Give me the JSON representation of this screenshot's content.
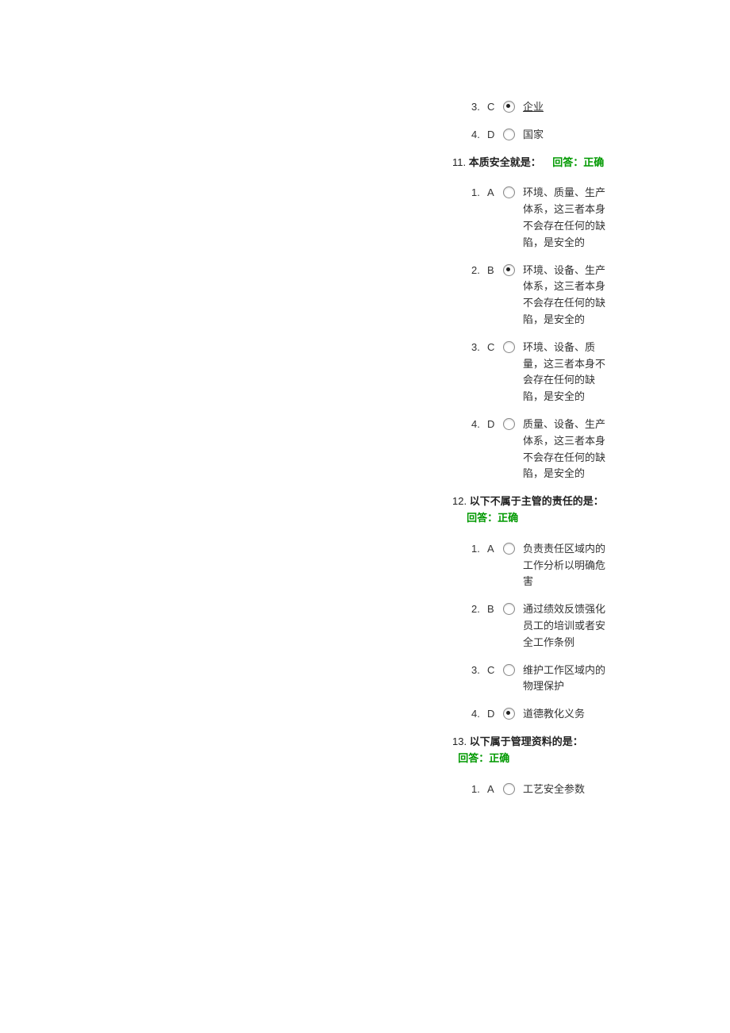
{
  "q_partial_top": {
    "options": [
      {
        "num": "3.",
        "letter": "C",
        "selected": true,
        "text": "企业",
        "underline": true
      },
      {
        "num": "4.",
        "letter": "D",
        "selected": false,
        "text": "国家"
      }
    ]
  },
  "q11": {
    "number": "11.",
    "title": "本质安全就是：",
    "answer_label": "回答：正确",
    "options": [
      {
        "num": "1.",
        "letter": "A",
        "selected": false,
        "text": "环境、质量、生产体系，这三者本身不会存在任何的缺陷，是安全的"
      },
      {
        "num": "2.",
        "letter": "B",
        "selected": true,
        "text": "环境、设备、生产体系，这三者本身不会存在任何的缺陷，是安全的"
      },
      {
        "num": "3.",
        "letter": "C",
        "selected": false,
        "text": "环境、设备、质量，这三者本身不会存在任何的缺陷，是安全的"
      },
      {
        "num": "4.",
        "letter": "D",
        "selected": false,
        "text": "质量、设备、生产体系，这三者本身不会存在任何的缺陷，是安全的"
      }
    ]
  },
  "q12": {
    "number": "12.",
    "title": "以下不属于主管的责任的是：",
    "answer_label": "回答：正确",
    "options": [
      {
        "num": "1.",
        "letter": "A",
        "selected": false,
        "text": "负责责任区域内的工作分析以明确危害"
      },
      {
        "num": "2.",
        "letter": "B",
        "selected": false,
        "text": "通过绩效反馈强化员工的培训或者安全工作条例"
      },
      {
        "num": "3.",
        "letter": "C",
        "selected": false,
        "text": "维护工作区域内的物理保护"
      },
      {
        "num": "4.",
        "letter": "D",
        "selected": true,
        "text": "道德教化义务"
      }
    ]
  },
  "q13": {
    "number": "13.",
    "title": "以下属于管理资料的是：",
    "answer_label": "回答：正确",
    "options": [
      {
        "num": "1.",
        "letter": "A",
        "selected": false,
        "text": "工艺安全参数"
      }
    ]
  }
}
